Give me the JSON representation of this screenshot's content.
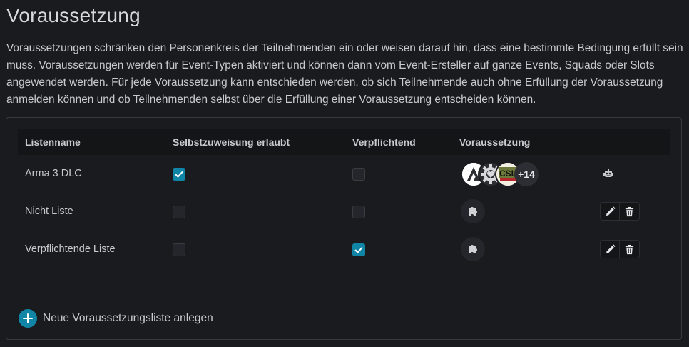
{
  "page": {
    "title": "Voraussetzung",
    "intro": "Voraussetzungen schränken den Personenkreis der Teilnehmenden ein oder weisen darauf hin, dass eine bestimmte Bedingung erfüllt sein muss. Voraussetzungen werden für Event-Typen aktiviert und können dann vom Event-Ersteller auf ganze Events, Squads oder Slots angewendet werden. Für jede Voraussetzung kann entschieden werden, ob sich Teilnehmende auch ohne Erfüllung der Voraussetzung anmelden können und ob Teilnehmenden selbst über die Erfüllung einer Voraussetzung entscheiden können."
  },
  "table": {
    "headers": [
      "Listenname",
      "Selbstzuweisung erlaubt",
      "Verpflichtend",
      "Voraussetzung"
    ],
    "rows": [
      {
        "name": "Arma 3 DLC",
        "self_assign": true,
        "mandatory": false,
        "requirements": [
          "arma-logo-icon",
          "gear-heart-icon",
          "csla-logo-icon"
        ],
        "more_count": "+14",
        "actions": [
          "robot-icon"
        ]
      },
      {
        "name": "Nicht Liste",
        "self_assign": false,
        "mandatory": false,
        "requirements": [
          "puzzle-icon"
        ],
        "actions": [
          "edit-icon",
          "trash-icon"
        ]
      },
      {
        "name": "Verpflichtende Liste",
        "self_assign": false,
        "mandatory": true,
        "requirements": [
          "puzzle-icon"
        ],
        "actions": [
          "edit-icon",
          "trash-icon"
        ]
      }
    ]
  },
  "add_button": {
    "label": "Neue Voraussetzungsliste anlegen",
    "icon": "plus-icon"
  },
  "colors": {
    "accent": "#1185a6",
    "background": "#1a1b1e",
    "header_bg": "#141517",
    "border": "#373a40"
  }
}
